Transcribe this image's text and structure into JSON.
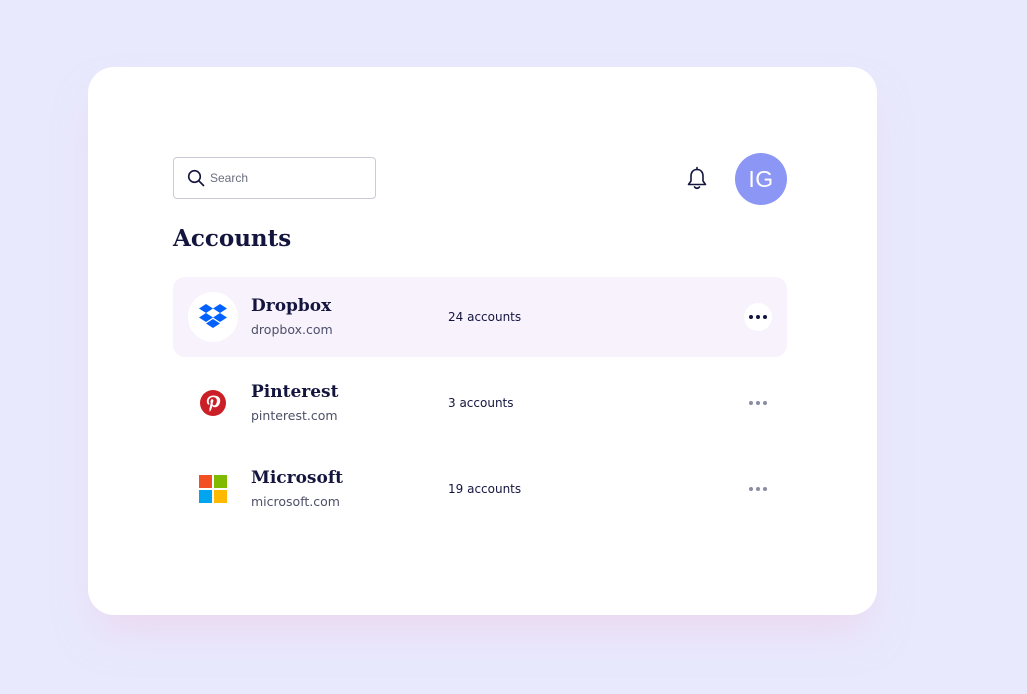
{
  "search": {
    "placeholder": "Search"
  },
  "header": {
    "avatar_initials": "IG"
  },
  "page_title": "Accounts",
  "accounts": [
    {
      "name": "Dropbox",
      "domain": "dropbox.com",
      "count": "24 accounts",
      "icon": "dropbox-logo-icon",
      "brand_color": "#0061fe"
    },
    {
      "name": "Pinterest",
      "domain": "pinterest.com",
      "count": "3 accounts",
      "icon": "pinterest-logo-icon",
      "brand_color": "#e60023"
    },
    {
      "name": "Microsoft",
      "domain": "microsoft.com",
      "count": "19 accounts",
      "icon": "microsoft-logo-icon",
      "brand_color": "#f25022"
    }
  ],
  "colors": {
    "background": "#e8e9fd",
    "card": "#ffffff",
    "title": "#14153f",
    "avatar": "#8b96f5",
    "highlight_row": "#f8f2fd"
  }
}
